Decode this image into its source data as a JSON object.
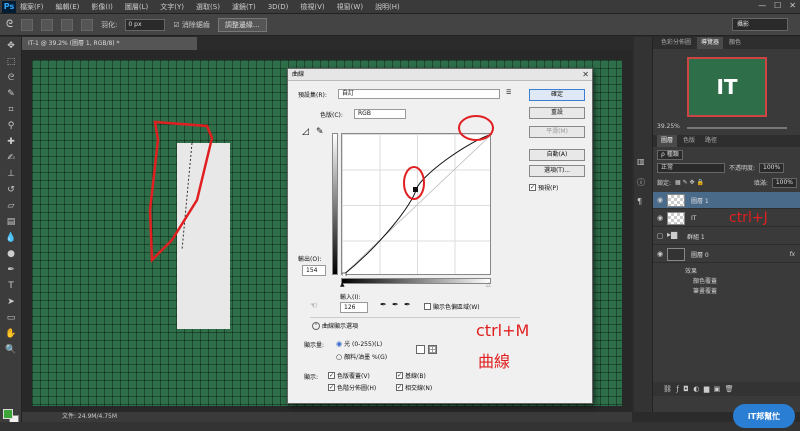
{
  "app": {
    "logo": "Ps",
    "menu": [
      "檔案(F)",
      "編輯(E)",
      "影像(I)",
      "圖層(L)",
      "文字(Y)",
      "選取(S)",
      "濾鏡(T)",
      "3D(D)",
      "檢視(V)",
      "視窗(W)",
      "說明(H)"
    ]
  },
  "options": {
    "feather_label": "羽化:",
    "feather_value": "0 px",
    "antialias_label": "消除鋸齒",
    "refine_button": "調整邊緣...",
    "workspace": "攝影"
  },
  "document": {
    "tab": "IT-1 @ 39.2% (圖層 1, RGB/8) *",
    "status": "文件: 24.9M/4.75M"
  },
  "navigator": {
    "tabs": [
      "色彩分佈圖",
      "導覽器",
      "顏色"
    ],
    "thumb_text": "IT",
    "zoom": "39.25%"
  },
  "layers": {
    "tabs": [
      "圖層",
      "色版",
      "路徑"
    ],
    "kind_filter": "ρ 種類",
    "blend_mode": "正常",
    "opacity_label": "不透明度:",
    "opacity": "100%",
    "lock_label": "鎖定:",
    "fill_label": "填滿:",
    "fill": "100%",
    "items": [
      {
        "name": "圖層 1",
        "selected": true
      },
      {
        "name": "IT",
        "selected": false
      },
      {
        "name": "群組 1",
        "selected": false
      },
      {
        "name": "圖層 0",
        "selected": false
      }
    ],
    "effects_label": "效果",
    "effects": [
      "顏色覆蓋",
      "筆畫覆蓋"
    ],
    "fx": "fx"
  },
  "dialog": {
    "title": "曲線",
    "close": "✕",
    "preset_label": "預設集(R):",
    "preset_value": "自訂",
    "channel_label": "色版(C):",
    "channel_value": "RGB",
    "output_label": "輸出(O):",
    "output_value": "154",
    "input_label": "輸入(I):",
    "input_value": "126",
    "show_clipping": "顯示色偏區域(W)",
    "display_options": "曲線顯示選項",
    "show_amount_label": "顯示量:",
    "light_option": "光 (0-255)(L)",
    "pigment_option": "顏料/油墨 %(G)",
    "show_label": "顯示:",
    "show_items": [
      "色版覆蓋(V)",
      "基線(B)",
      "色階分佈圖(H)",
      "相交線(N)"
    ],
    "buttons": {
      "ok": "確定",
      "reset": "重設",
      "smooth": "平滑(M)",
      "auto": "自動(A)",
      "options": "選項(T)...",
      "preview": "預視(P)"
    }
  },
  "annotations": {
    "ctrl_j": "ctrl+J",
    "ctrl_m": "ctrl+M",
    "curves": "曲線"
  },
  "watermark": "iT邦幫忙",
  "colors": {
    "canvas_green": "#2e6f4a",
    "annotation_red": "#e02020"
  }
}
